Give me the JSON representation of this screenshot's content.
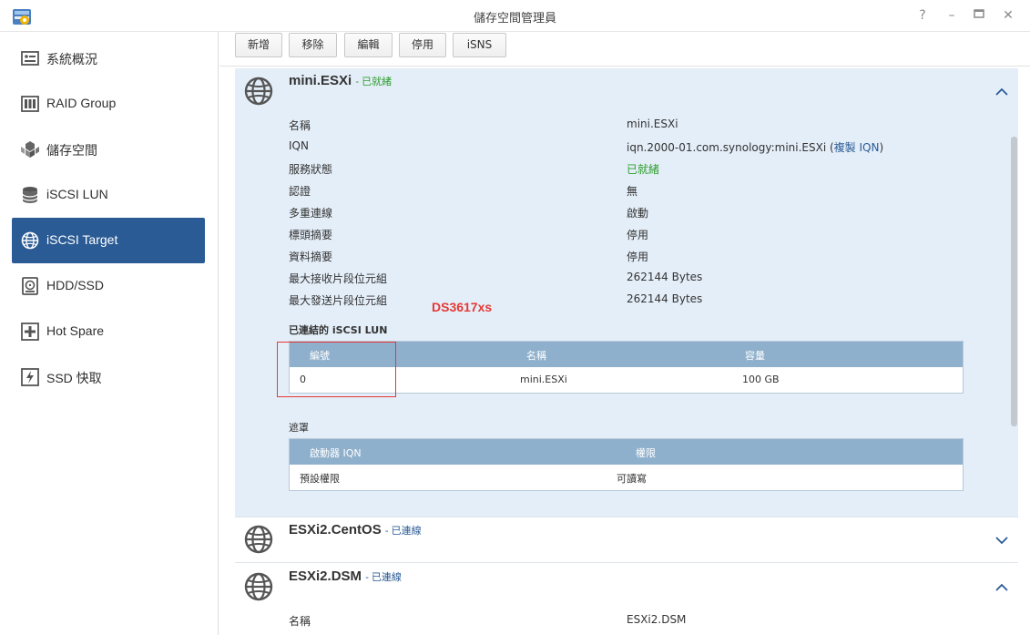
{
  "window": {
    "title": "儲存空間管理員",
    "buttons": [
      "?",
      "–",
      "▭",
      "✕"
    ]
  },
  "sidebar": {
    "items": [
      {
        "label": "系統概況",
        "icon": "overview-icon",
        "active": false
      },
      {
        "label": "RAID Group",
        "icon": "raid-icon",
        "active": false
      },
      {
        "label": "儲存空間",
        "icon": "volume-icon",
        "active": false
      },
      {
        "label": "iSCSI LUN",
        "icon": "lun-icon",
        "active": false
      },
      {
        "label": "iSCSI Target",
        "icon": "target-globe-icon",
        "active": true
      },
      {
        "label": "HDD/SSD",
        "icon": "disk-icon",
        "active": false
      },
      {
        "label": "Hot Spare",
        "icon": "hot-spare-icon",
        "active": false
      },
      {
        "label": "SSD 快取",
        "icon": "ssd-cache-icon",
        "active": false
      }
    ]
  },
  "toolbar": {
    "create": "新增",
    "remove": "移除",
    "edit": "編輯",
    "disable": "停用",
    "isns": "iSNS"
  },
  "targets": [
    {
      "name": "mini.ESXi",
      "status": "- 已就緒",
      "status_color": "#2e9e2e",
      "expanded": true,
      "details": [
        {
          "key": "名稱",
          "value": "mini.ESXi"
        },
        {
          "key": "IQN",
          "value": "iqn.2000-01.com.synology:mini.ESXi (",
          "link": "複製 IQN",
          "tail": ")"
        },
        {
          "key": "服務狀態",
          "value": "已就緒"
        },
        {
          "key": "認證",
          "value": "無"
        },
        {
          "key": "多重連線",
          "value": "啟動"
        },
        {
          "key": "標頭摘要",
          "value": "停用"
        },
        {
          "key": "資料摘要",
          "value": "停用"
        },
        {
          "key": "最大接收片段位元組",
          "value": "262144 Bytes"
        },
        {
          "key": "最大發送片段位元組",
          "value": "262144 Bytes"
        }
      ],
      "lun_section_title": "已連結的 iSCSI LUN",
      "lun_table": {
        "headers": [
          "編號",
          "名稱",
          "容量"
        ],
        "rows": [
          [
            "0",
            "mini.ESXi",
            "100 GB"
          ]
        ]
      },
      "mask_section_title": "遮罩",
      "mask_table": {
        "headers": [
          "啟動器 IQN",
          "權限"
        ],
        "rows": [
          [
            "預設權限",
            "可讀寫"
          ]
        ]
      }
    },
    {
      "name": "ESXi2.CentOS",
      "status": "- 已連線",
      "status_color": "#2a5b94",
      "expanded": false
    },
    {
      "name": "ESXi2.DSM",
      "status": "- 已連線",
      "status_color": "#2a5b94",
      "expanded": true,
      "details": [
        {
          "key": "名稱",
          "value": "ESXi2.DSM"
        }
      ]
    }
  ],
  "annotation": {
    "text": "DS3617xs",
    "color": "#e53935"
  }
}
